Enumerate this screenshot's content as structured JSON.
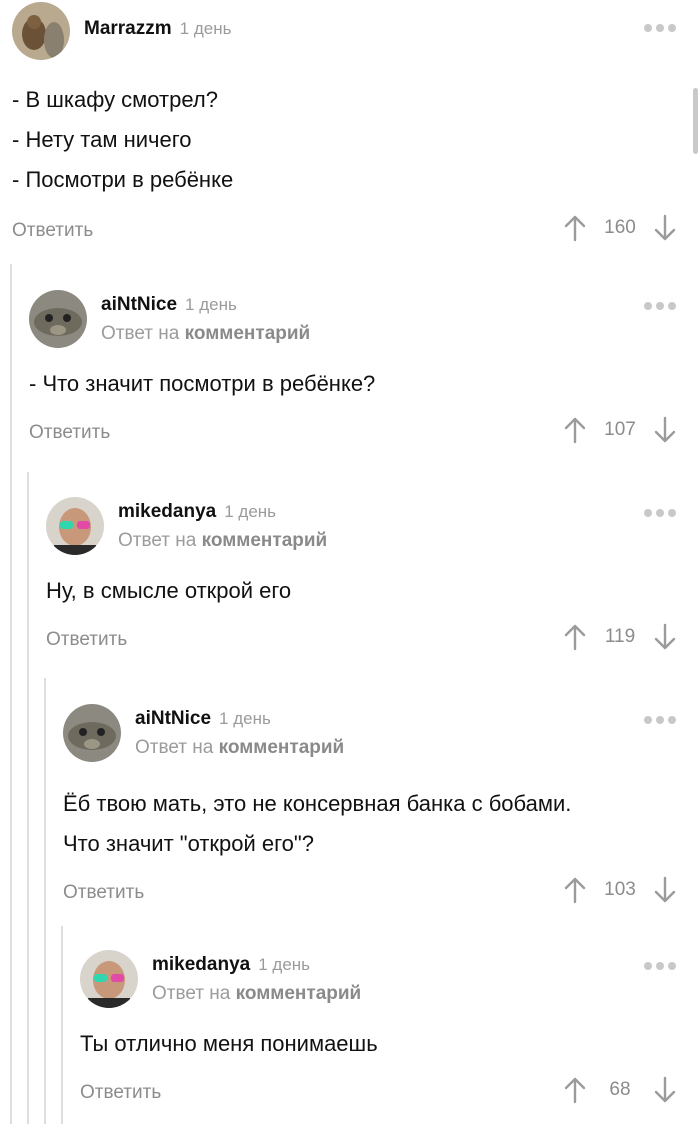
{
  "comments": [
    {
      "username": "Marrazzm",
      "time": "1 день",
      "lines": [
        "- В шкафу смотрел?",
        "- Нету там ничего",
        "- Посмотри в ребёнке"
      ],
      "reply_label": "Ответить",
      "rating": "160"
    },
    {
      "username": "aiNtNice",
      "time": "1 день",
      "reply_prefix": "Ответ на",
      "reply_link": "комментарий",
      "lines": [
        "- Что значит посмотри в ребёнке?"
      ],
      "reply_label": "Ответить",
      "rating": "107"
    },
    {
      "username": "mikedanya",
      "time": "1 день",
      "reply_prefix": "Ответ на",
      "reply_link": "комментарий",
      "lines": [
        "Ну, в смысле открой его"
      ],
      "reply_label": "Ответить",
      "rating": "119"
    },
    {
      "username": "aiNtNice",
      "time": "1 день",
      "reply_prefix": "Ответ на",
      "reply_link": "комментарий",
      "lines": [
        "Ёб твою мать, это не консервная банка с бобами.",
        "Что значит \"открой его\"?"
      ],
      "reply_label": "Ответить",
      "rating": "103"
    },
    {
      "username": "mikedanya",
      "time": "1 день",
      "reply_prefix": "Ответ на",
      "reply_link": "комментарий",
      "lines": [
        "Ты отлично меня понимаешь"
      ],
      "reply_label": "Ответить",
      "rating": "68"
    }
  ],
  "icons": {
    "upvote": "arrow-up-icon",
    "downvote": "arrow-down-icon",
    "more": "more-dots-icon"
  },
  "colors": {
    "muted_text": "#8c8c8c",
    "thread_line": "#dedede"
  }
}
